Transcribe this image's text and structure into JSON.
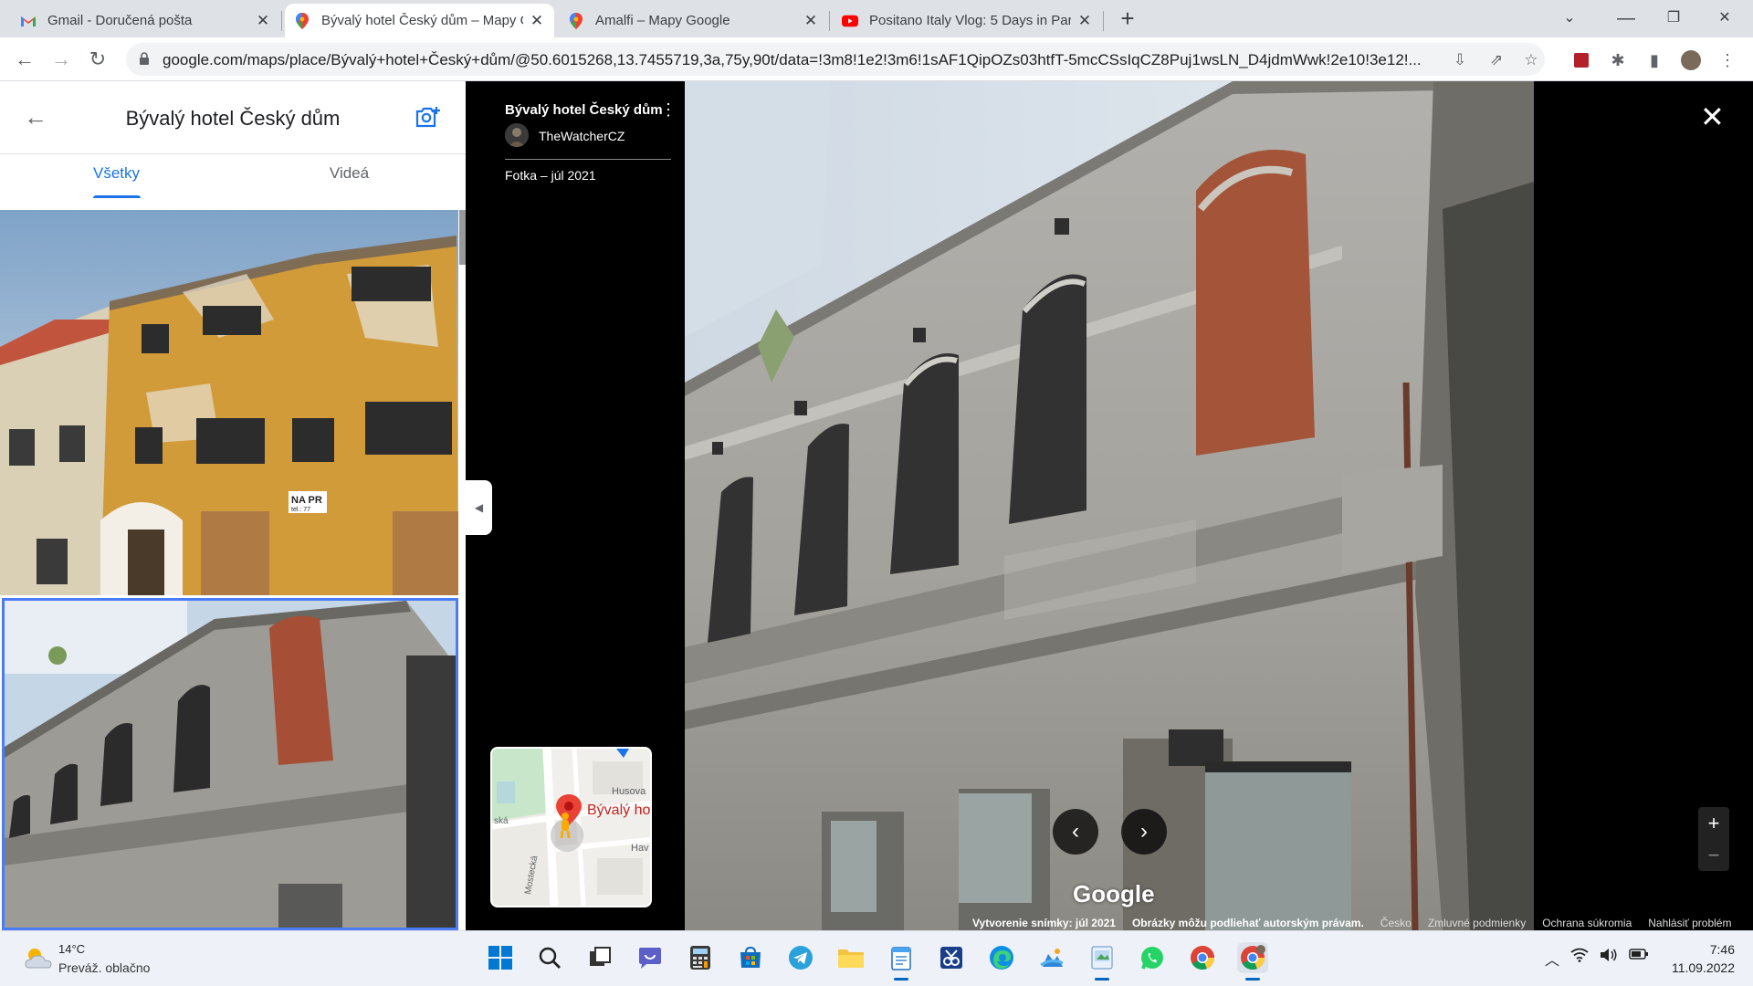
{
  "browser": {
    "tabs": [
      {
        "title": "Gmail - Doručená pošta",
        "icon": "gmail-icon"
      },
      {
        "title": "Bývalý hotel Český dům – Mapy G",
        "icon": "maps-pin-icon"
      },
      {
        "title": "Amalfi – Mapy Google",
        "icon": "maps-pin-icon"
      },
      {
        "title": "Positano Italy Vlog: 5 Days in Par",
        "icon": "youtube-icon"
      }
    ],
    "active_tab": 1,
    "url": "google.com/maps/place/Bývalý+hotel+Český+dům/@50.6015268,13.7455719,3a,75y,90t/data=!3m8!1e2!3m6!1sAF1QipOZs03htfT-5mcCSsIqCZ8Puj1wsLN_D4jdmWwk!2e10!3e12!..."
  },
  "left_panel": {
    "title": "Bývalý hotel Český dům",
    "tabs": [
      "Všetky",
      "Videá"
    ],
    "active_tab": 0,
    "photo1_sign": "NA PR",
    "photo1_sign2": "tel.: 77"
  },
  "info": {
    "place": "Bývalý hotel Český dům",
    "author": "TheWatcherCZ",
    "date": "Fotka – júl 2021"
  },
  "minimap": {
    "street_husova": "Husova",
    "place_label": "Bývalý ho",
    "street_ska": "ská",
    "street_mostecka": "Mostecká",
    "street_hav": "Hav"
  },
  "viewer": {
    "watermark": "Google",
    "footer": {
      "captured": "Vytvorenie snímky: júl 2021",
      "copyright": "Obrázky môžu podliehať autorským právam.",
      "country": "Česko",
      "terms": "Zmluvné podmienky",
      "privacy": "Ochrana súkromia",
      "report": "Nahlásiť problém"
    }
  },
  "taskbar": {
    "temp": "14°C",
    "condition": "Preváž. oblačno",
    "time": "7:46",
    "date": "11.09.2022"
  },
  "colors": {
    "accent": "#1a73e8",
    "selection_border": "#4a7cf7",
    "maps_pin": "#ea4335"
  }
}
